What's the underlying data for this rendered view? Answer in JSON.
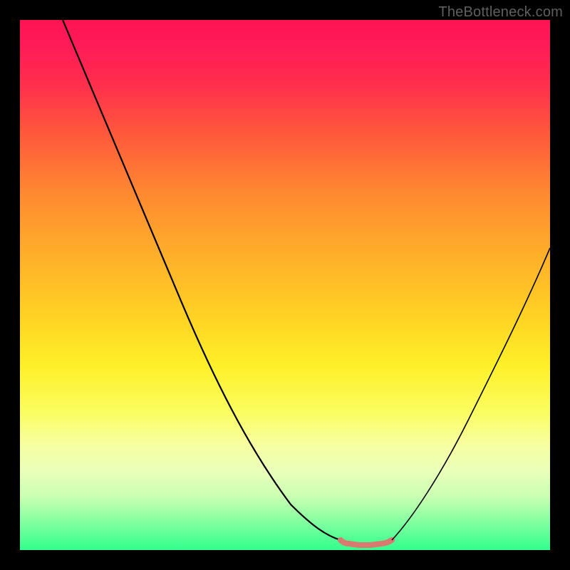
{
  "watermark": "TheBottleneck.com",
  "chart_data": {
    "type": "line",
    "title": "",
    "xlabel": "",
    "ylabel": "",
    "xlim": [
      0,
      100
    ],
    "ylim": [
      0,
      100
    ],
    "grid": false,
    "legend": false,
    "note": "V-shaped bottleneck curve on a red-to-green vertical gradient. Minimum (bottleneck ~0) occurs around x≈61–70 where a short salmon-pink flat segment sits at the bottom. No numeric axis ticks are visible in the image; values below are pixel-estimated percentages.",
    "series": [
      {
        "name": "left-branch",
        "color": "#000000",
        "x": [
          8,
          15,
          22,
          30,
          38,
          45,
          52,
          58,
          61
        ],
        "values": [
          100,
          87,
          73,
          58,
          42,
          28,
          15,
          6,
          2
        ]
      },
      {
        "name": "flat-minimum",
        "color": "#d97a70",
        "x": [
          61,
          63,
          65,
          67,
          69,
          70
        ],
        "values": [
          2,
          1,
          1,
          1,
          1,
          2
        ]
      },
      {
        "name": "right-branch",
        "color": "#000000",
        "x": [
          70,
          76,
          82,
          88,
          94,
          100
        ],
        "values": [
          2,
          11,
          22,
          34,
          46,
          58
        ]
      }
    ],
    "gradient_stops": [
      {
        "pos": 0,
        "color": "#ff1452"
      },
      {
        "pos": 50,
        "color": "#ffd223"
      },
      {
        "pos": 100,
        "color": "#33ff8e"
      }
    ]
  }
}
